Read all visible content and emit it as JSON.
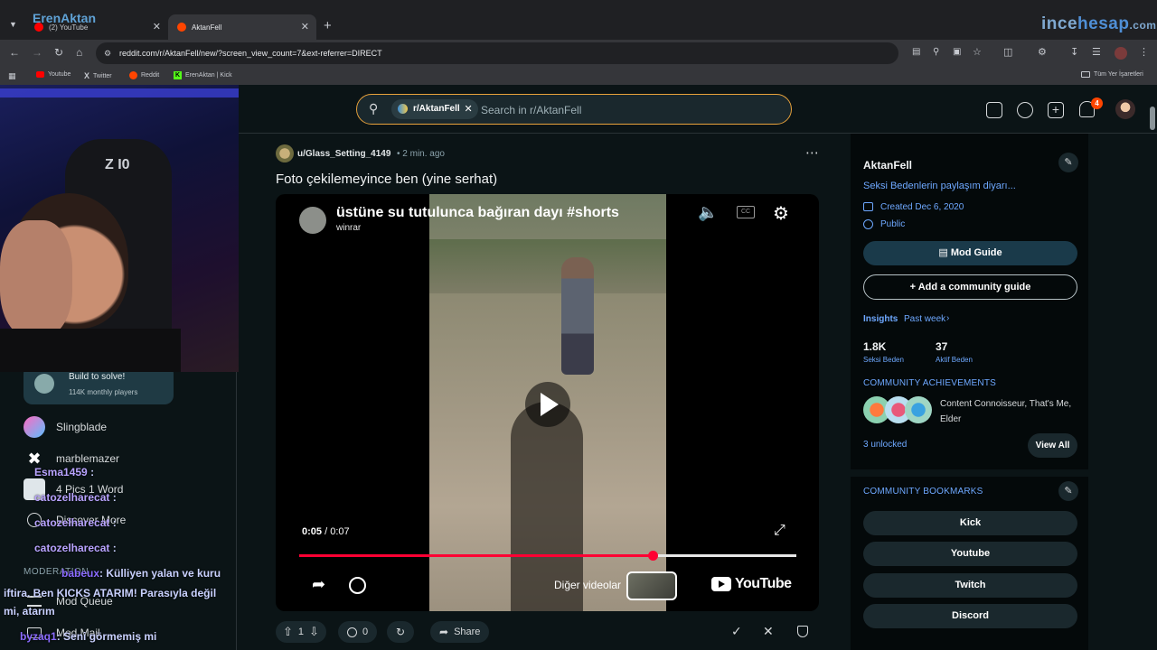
{
  "browser": {
    "tabs": [
      {
        "label": "(2) YouTube",
        "active": false
      },
      {
        "label": "AktanFell",
        "active": true
      }
    ],
    "url": "reddit.com/r/AktanFell/new/?screen_view_count=7&ext-referrer=DIRECT",
    "bookmarks": [
      "Youtube",
      "Twitter",
      "Reddit",
      "ErenAktan | Kick"
    ],
    "all_bookmarks": "Tüm Yer İşaretleri"
  },
  "watermark": {
    "left": "ErenAktan",
    "right_a": "ince",
    "right_b": "hesap",
    "right_c": ".com"
  },
  "header": {
    "community_chip": "r/AktanFell",
    "search_placeholder": "Search in r/AktanFell",
    "notification_count": "4"
  },
  "left_nav": {
    "game_title": "Build to solve!",
    "game_players": "114K monthly players",
    "items": [
      "Slingblade",
      "marblemazer",
      "4 Pics 1 Word",
      "Discover More"
    ],
    "moderation_label": "MODERATION",
    "mod_queue": "Mod Queue",
    "mod_mail": "Mod Mail"
  },
  "chat": [
    {
      "user": "Esma1459",
      "text": ":"
    },
    {
      "user": "catozelharecat",
      "text": ":"
    },
    {
      "user": "catozelharecat",
      "text": ":"
    },
    {
      "user": "catozelharecat",
      "text": ":"
    },
    {
      "user": "babeux",
      "text": ": Külliyen yalan ve kuru"
    },
    {
      "user": "",
      "text": "iftira. Ben KICKS ATARIM! Parasıyla değil"
    },
    {
      "user": "",
      "text": "mi, atarım"
    },
    {
      "user": "byzaq1",
      "text": ": Seni görmemiş mi"
    }
  ],
  "post": {
    "author": "u/Glass_Setting_4149",
    "time": "• 2 min. ago",
    "title": "Foto çekilemeyince ben (yine serhat)",
    "upvotes": "1",
    "comments": "0",
    "share_label": "Share"
  },
  "video": {
    "title": "üstüne su tutulunca bağıran dayı #shorts",
    "channel": "winrar",
    "current_time": "0:05",
    "separator": "/",
    "duration": "0:07",
    "progress": 0.71,
    "more_videos": "Diğer videolar",
    "youtube_label": "YouTube"
  },
  "sidebar": {
    "name": "AktanFell",
    "description": "Seksi Bedenlerin paylaşım diyarı...",
    "created": "Created Dec 6, 2020",
    "visibility": "Public",
    "mod_guide": "Mod Guide",
    "add_guide": "Add a community guide",
    "insights": "Insights",
    "insights_period": "Past week",
    "members_value": "1.8K",
    "members_label": "Seksi Beden",
    "online_value": "37",
    "online_label": "Aktif Beden",
    "achievements_title": "COMMUNITY ACHIEVEMENTS",
    "achievements_text": "Content Connoisseur, That's Me, Elder",
    "unlocked": "3 unlocked",
    "view_all": "View All",
    "bookmarks_title": "COMMUNITY BOOKMARKS",
    "bookmarks": [
      "Kick",
      "Youtube",
      "Twitch",
      "Discord"
    ]
  },
  "colors": {
    "accent": "#e8a23b",
    "progress": "#ff0033",
    "link": "#6ea8ff",
    "notification": "#ff4500"
  }
}
